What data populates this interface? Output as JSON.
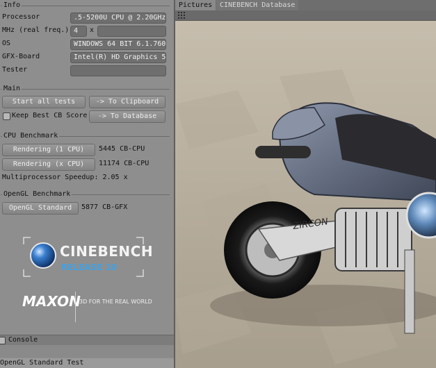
{
  "info": {
    "title": "Info",
    "processor_label": "Processor",
    "processor_value": ".5-5200U CPU @ 2.20GHz",
    "mhz_label": "MHz (real freq.)",
    "mhz_value": "4",
    "mhz_x": "x",
    "os_label": "OS",
    "os_value": "WINDOWS 64 BIT 6.1.760",
    "gfx_label": "GFX-Board",
    "gfx_value": "Intel(R) HD Graphics 5",
    "tester_label": "Tester",
    "tester_value": ""
  },
  "main": {
    "title": "Main",
    "start_all_label": "Start all tests",
    "to_clipboard_label": "-> To Clipboard",
    "keep_best_label": "Keep Best CB Score",
    "to_database_label": "-> To Database"
  },
  "cpu": {
    "title": "CPU Benchmark",
    "render1_label": "Rendering (1 CPU)",
    "render1_result": "5445 CB-CPU",
    "renderx_label": "Rendering (x CPU)",
    "renderx_result": "11174 CB-CPU",
    "speedup_text": "Multiprocessor Speedup: 2.05 x"
  },
  "opengl": {
    "title": "OpenGL Benchmark",
    "standard_label": "OpenGL Standard",
    "standard_result": "5877 CB-GFX"
  },
  "brand": {
    "product": "CINEBENCH",
    "release": "RELEASE 10",
    "company": "MAXON",
    "tagline": "3D FOR THE REAL WORLD"
  },
  "console": {
    "label": "Console",
    "status": "OpenGL Standard Test"
  },
  "tabs": [
    {
      "label": "Pictures"
    },
    {
      "label": "CINEBENCH Database"
    }
  ],
  "render_tag": "ZIRCON"
}
